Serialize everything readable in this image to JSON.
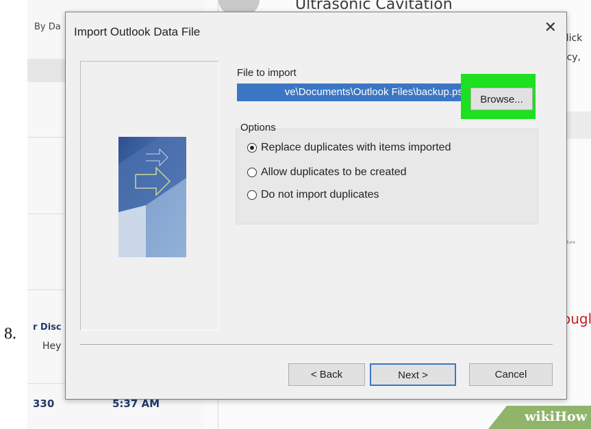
{
  "step_number": "8.",
  "background": {
    "list_header": "By Da",
    "email_title": "Ultrasonic Cavitation",
    "right_text_1": "click",
    "right_text_2": "acy,",
    "red_text": "ougl",
    "tiny_text": "picture",
    "sender": "r Disc",
    "preview": "Hey",
    "number": "330",
    "time": "5:37 AM"
  },
  "dialog": {
    "title": "Import Outlook Data File",
    "close_glyph": "✕",
    "file_label": "File to import",
    "file_path": "ve\\Documents\\Outlook Files\\backup.pst",
    "browse_label": "Browse...",
    "options_label": "Options",
    "options": [
      {
        "label": "Replace duplicates with items imported",
        "selected": true
      },
      {
        "label": "Allow duplicates to be created",
        "selected": false
      },
      {
        "label": "Do not import duplicates",
        "selected": false
      }
    ],
    "back_label": "< Back",
    "next_label": "Next >",
    "cancel_label": "Cancel"
  },
  "watermark": "wikiHow",
  "colors": {
    "highlight": "#1ce020",
    "selection": "#3b76c4",
    "dialog_bg": "#f0f0f0"
  }
}
